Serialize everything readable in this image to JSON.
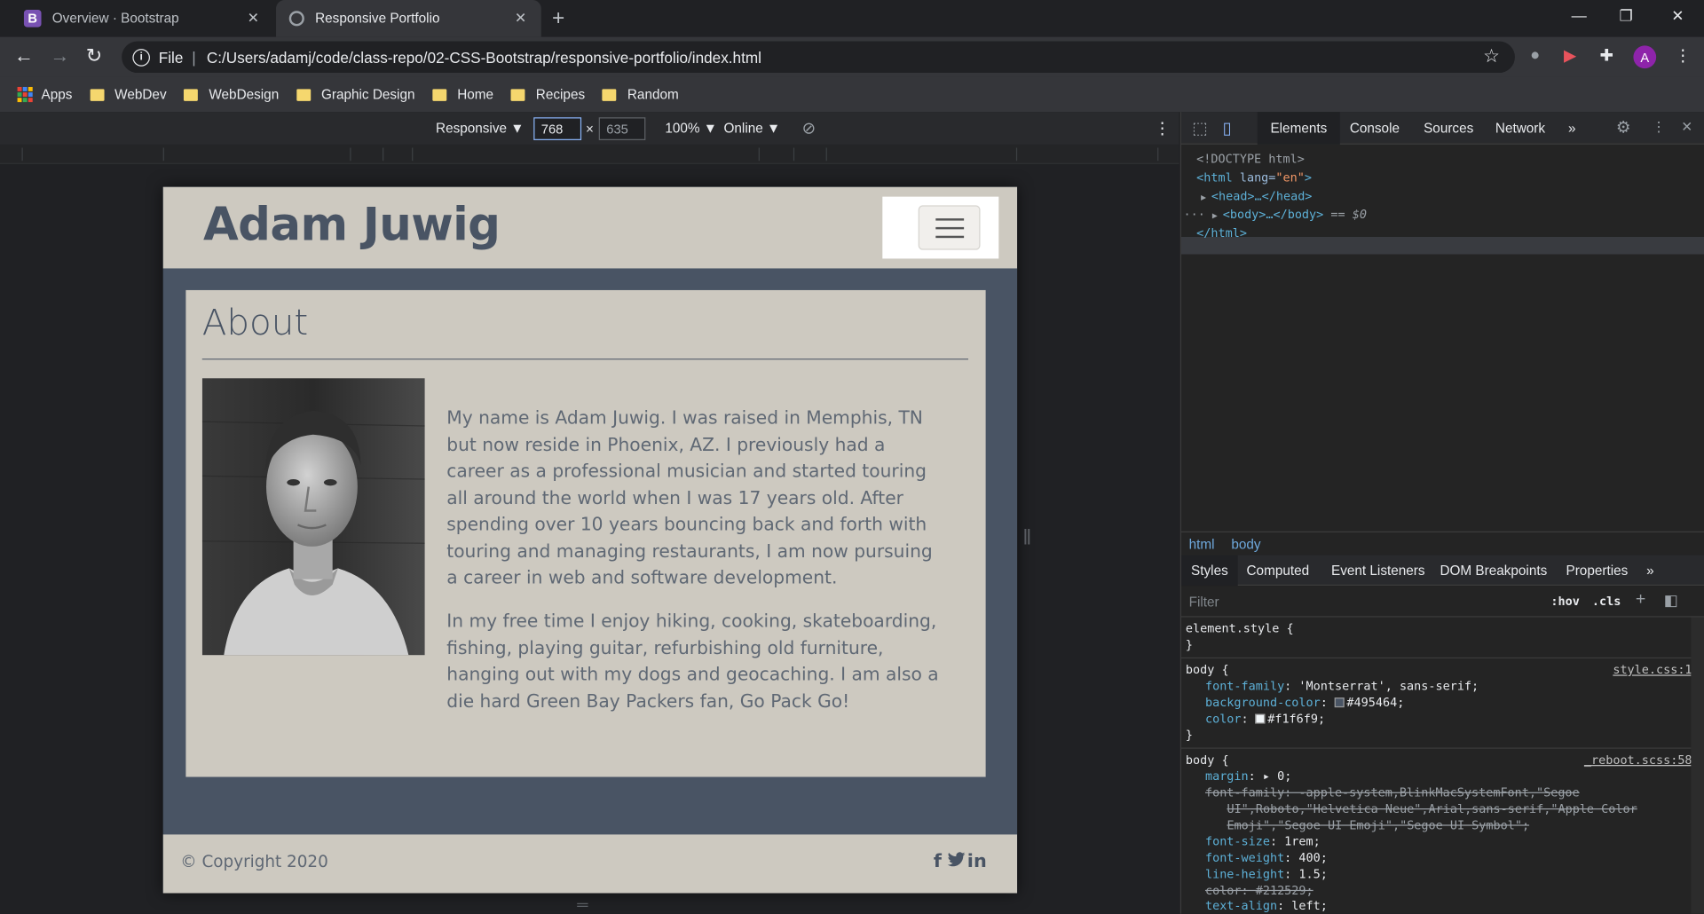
{
  "browser": {
    "tabs": [
      {
        "title": "Overview · Bootstrap",
        "favicon": "B"
      },
      {
        "title": "Responsive Portfolio"
      }
    ],
    "omnibox": {
      "scheme": "File",
      "url": "C:/Users/adamj/code/class-repo/02-CSS-Bootstrap/responsive-portfolio/index.html"
    },
    "avatar": "A",
    "bookmarks": [
      "Apps",
      "WebDev",
      "WebDesign",
      "Graphic Design",
      "Home",
      "Recipes",
      "Random"
    ]
  },
  "device_toolbar": {
    "mode": "Responsive ▼",
    "width": "768",
    "times": "×",
    "height": "635",
    "zoom": "100% ▼",
    "network": "Online ▼"
  },
  "page": {
    "brand": "Adam Juwig",
    "heading": "About",
    "bio": [
      "My name is Adam Juwig. I was raised in Memphis, TN but now reside in Phoenix, AZ. I previously had a career as a professional musician and started touring all around the world when I was 17 years old. After spending over 10 years bouncing back and forth with touring and managing restaurants, I am now pursuing a career in web and software development.",
      "In my free time I enjoy hiking, cooking, skateboarding, fishing, playing guitar, refurbishing old furniture, hanging out with my dogs and geocaching. I am also a die hard Green Bay Packers fan, Go Pack Go!"
    ],
    "copyright": "© Copyright 2020",
    "social": [
      "f",
      "in"
    ]
  },
  "devtools": {
    "tabs": [
      "Elements",
      "Console",
      "Sources",
      "Network",
      "»"
    ],
    "dom": {
      "doctype": "<!DOCTYPE html>",
      "html_open_tag": "<html",
      "lang_attr": "lang",
      "lang_val": "\"en\"",
      "head": "<head>…</head>",
      "body": "<body>…</body>",
      "body_marker": "== $0",
      "html_close": "</html>"
    },
    "breadcrumbs": [
      "html",
      "body"
    ],
    "subtabs": [
      "Styles",
      "Computed",
      "Event Listeners",
      "DOM Breakpoints",
      "Properties",
      "»"
    ],
    "filter_placeholder": "Filter",
    "hov": ":hov",
    "cls": ".cls",
    "styles": {
      "element_style": "element.style {",
      "close": "}",
      "rule1": {
        "selector": "body {",
        "source": "style.css:1",
        "font_family_prop": "font-family",
        "font_family_val": "'Montserrat', sans-serif;",
        "bg_prop": "background-color",
        "bg_val": "#495464;",
        "color_prop": "color",
        "color_val": "#f1f6f9;"
      },
      "rule2": {
        "selector": "body {",
        "source": "_reboot.scss:58",
        "margin_prop": "margin",
        "margin_val": "▸ 0;",
        "ff_strike_1": "font-family: -apple-system,BlinkMacSystemFont,\"Segoe",
        "ff_strike_2": "UI\",Roboto,\"Helvetica Neue\",Arial,sans-serif,\"Apple Color",
        "ff_strike_3": "Emoji\",\"Segoe UI Emoji\",\"Segoe UI Symbol\";",
        "fs_prop": "font-size",
        "fs_val": "1rem;",
        "fw_prop": "font-weight",
        "fw_val": "400;",
        "lh_prop": "line-height",
        "lh_val": "1.5;",
        "color_strike": "color: #212529;",
        "ta_prop": "text-align",
        "ta_val": "left;"
      }
    }
  },
  "colors": {
    "page_bg": "#495464",
    "card_bg": "#cdc9c0",
    "body_text": "#f1f6f9"
  }
}
